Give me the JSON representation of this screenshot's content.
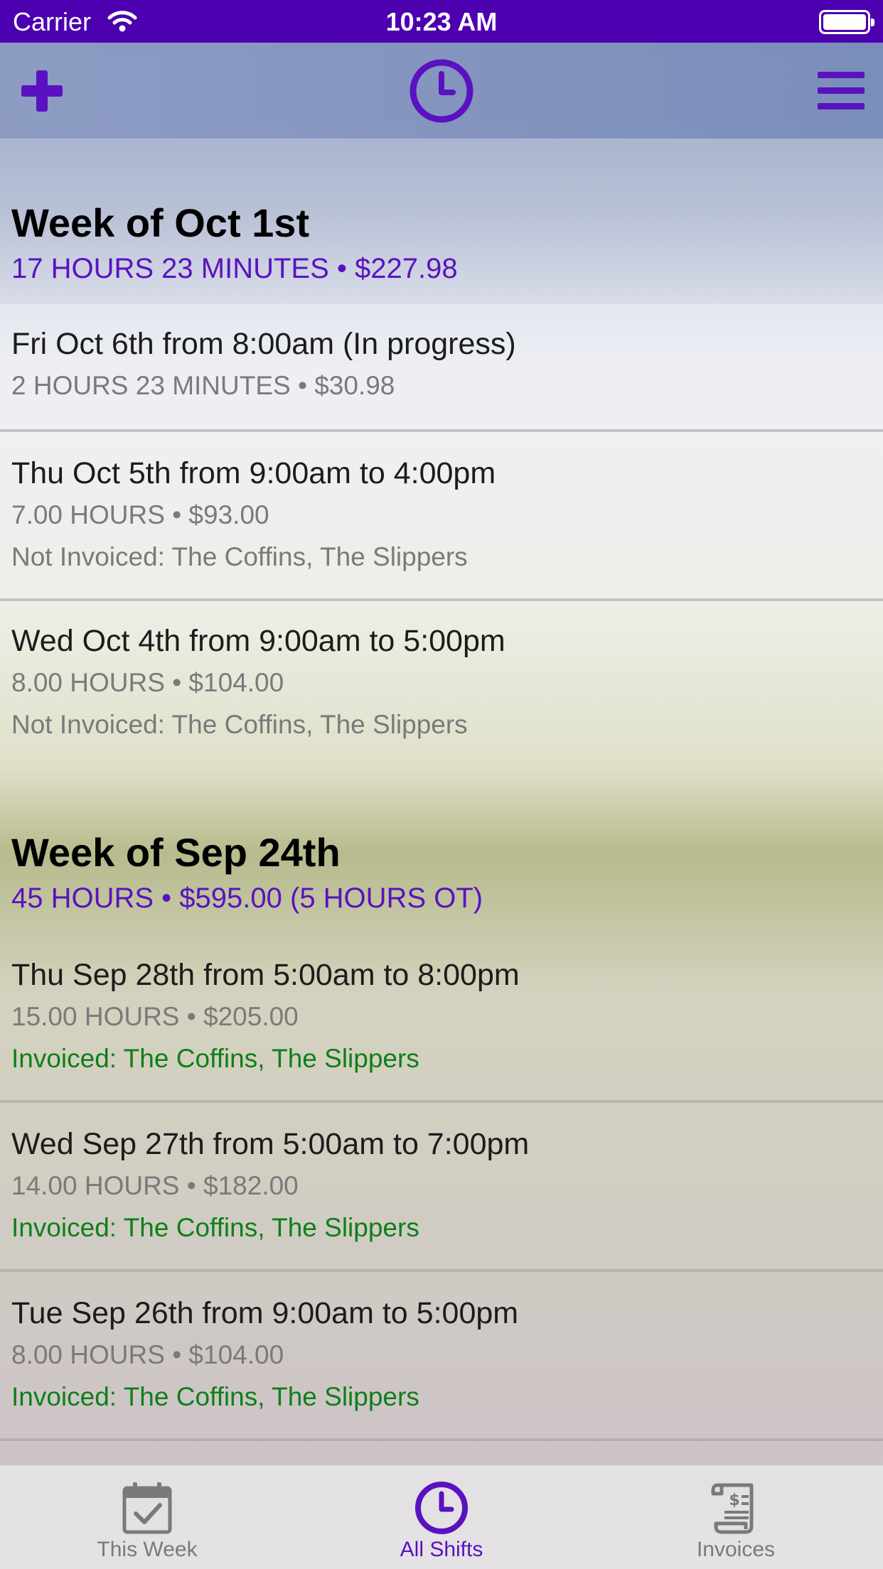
{
  "status_bar": {
    "carrier": "Carrier",
    "time": "10:23 AM"
  },
  "nav": {
    "add_icon": "plus-icon",
    "clock_icon": "clock-icon",
    "menu_icon": "hamburger-menu-icon"
  },
  "colors": {
    "accent": "#5a12c0",
    "status_bar": "#4c00b0",
    "invoiced": "#0e7f1a",
    "muted": "#7a7a7a"
  },
  "weeks": [
    {
      "title": "Week of Oct 1st",
      "summary": "17 HOURS 23 MINUTES • $227.98",
      "shifts": [
        {
          "title": "Fri Oct 6th from 8:00am (In progress)",
          "detail": "2 HOURS 23 MINUTES • $30.98",
          "status": ""
        },
        {
          "title": "Thu Oct 5th from 9:00am to 4:00pm",
          "detail": "7.00 HOURS • $93.00",
          "status": "Not Invoiced: The Coffins, The Slippers"
        },
        {
          "title": "Wed Oct 4th from 9:00am to 5:00pm",
          "detail": "8.00 HOURS • $104.00",
          "status": "Not Invoiced: The Coffins, The Slippers"
        }
      ]
    },
    {
      "title": "Week of Sep 24th",
      "summary": "45 HOURS • $595.00 (5 HOURS OT)",
      "shifts": [
        {
          "title": "Thu Sep 28th from 5:00am to 8:00pm",
          "detail": "15.00 HOURS • $205.00",
          "status": "Invoiced: The Coffins, The Slippers"
        },
        {
          "title": "Wed Sep 27th from 5:00am to 7:00pm",
          "detail": "14.00 HOURS • $182.00",
          "status": "Invoiced: The Coffins, The Slippers"
        },
        {
          "title": "Tue Sep 26th from 9:00am to 5:00pm",
          "detail": "8.00 HOURS • $104.00",
          "status": "Invoiced: The Coffins, The Slippers"
        }
      ]
    }
  ],
  "tabs": [
    {
      "label": "This Week",
      "icon": "calendar-check-icon",
      "active": false
    },
    {
      "label": "All Shifts",
      "icon": "clock-icon",
      "active": true
    },
    {
      "label": "Invoices",
      "icon": "invoice-scroll-icon",
      "active": false
    }
  ]
}
